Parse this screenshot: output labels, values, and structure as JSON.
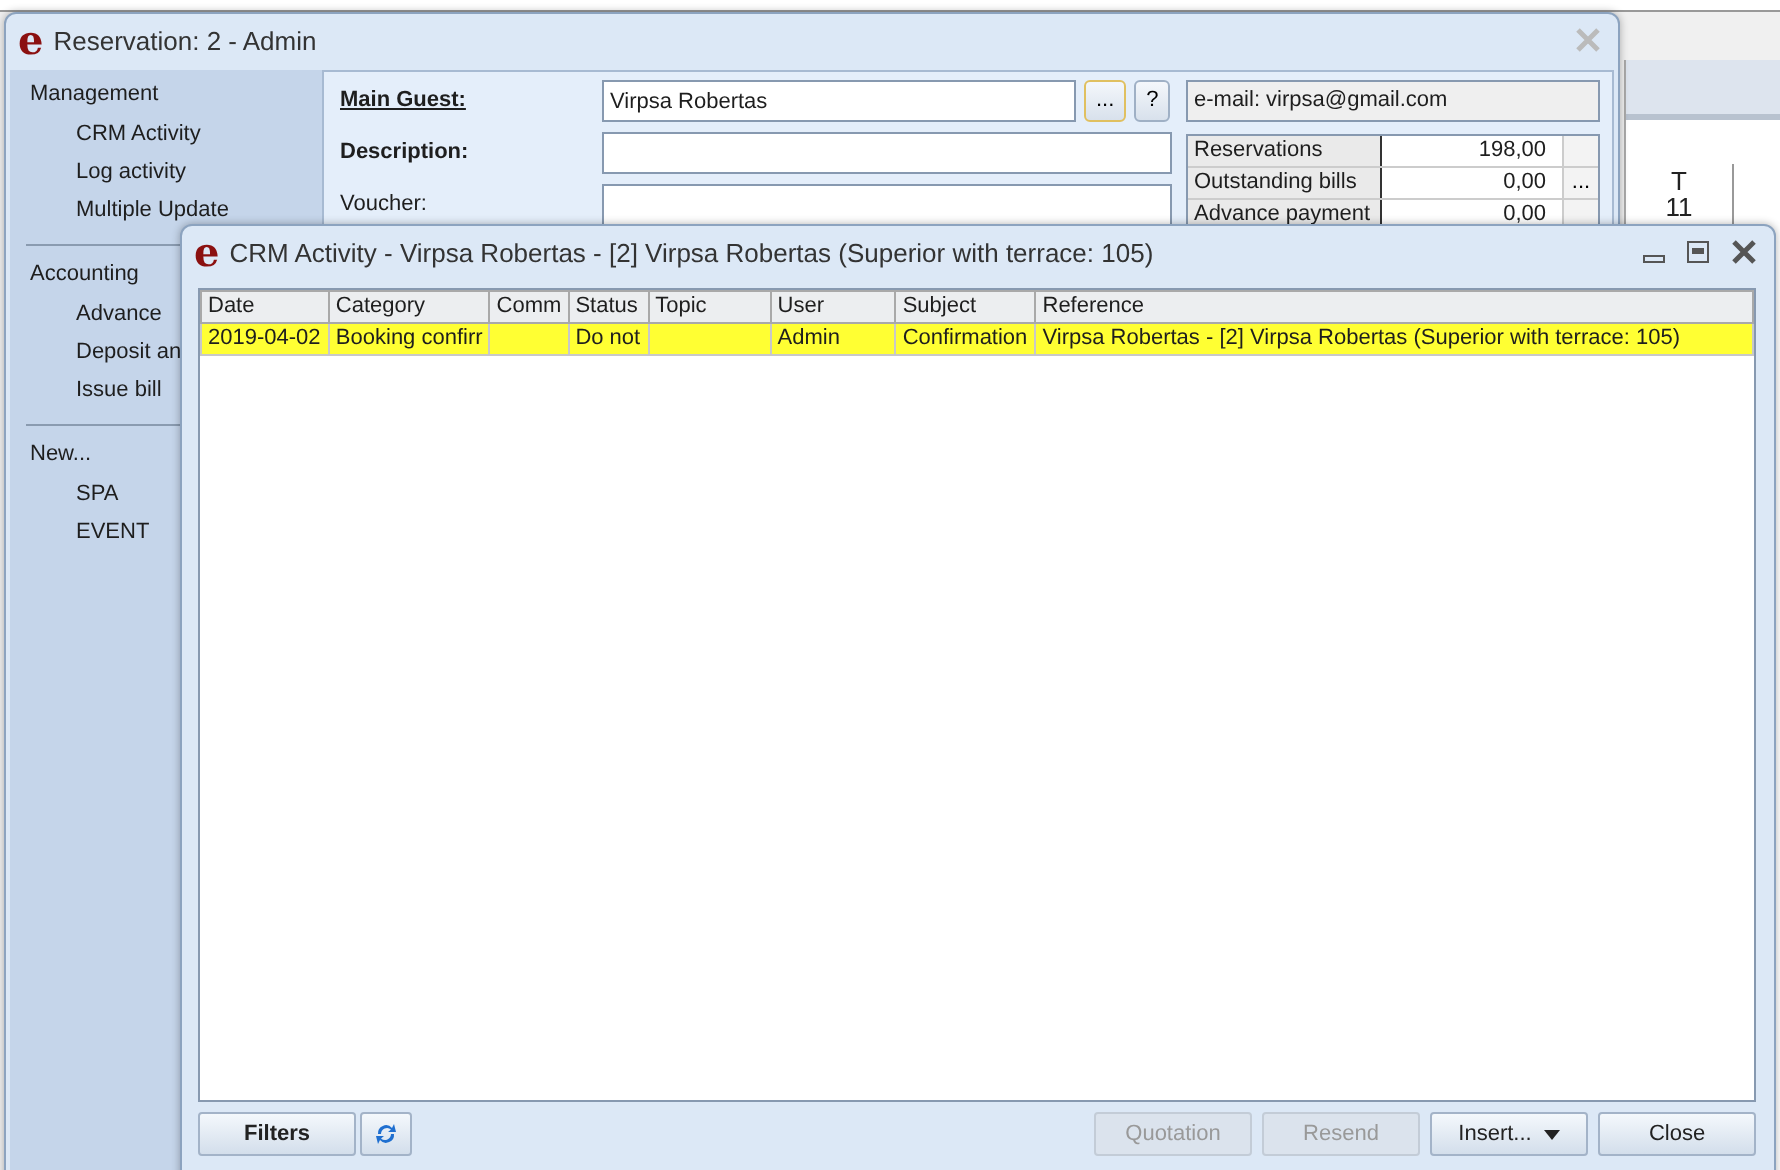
{
  "background_calendar": {
    "day": "T",
    "date": "11"
  },
  "reservation_window": {
    "logo": "e",
    "title": "Reservation: 2 - Admin",
    "sidebar": [
      {
        "heading": "Management",
        "items": [
          "CRM Activity",
          "Log activity",
          "Multiple Update"
        ]
      },
      {
        "heading": "Accounting",
        "items": [
          "Advance",
          "Deposit an",
          "Issue bill"
        ]
      },
      {
        "heading": "New...",
        "items": [
          "SPA",
          "EVENT"
        ]
      }
    ],
    "fields": [
      {
        "label": "Main Guest:",
        "kind": "guest",
        "value": "Virpsa Robertas"
      },
      {
        "label": "Description:",
        "kind": "bold"
      },
      {
        "label": "Voucher:",
        "kind": "plain"
      }
    ],
    "guest_buttons": [
      "...",
      "?"
    ],
    "email": "e-mail: virpsa@gmail.com",
    "summary": [
      {
        "label": "Reservations",
        "value": "198,00"
      },
      {
        "label": "Outstanding bills",
        "value": "0,00",
        "button": "..."
      },
      {
        "label": "Advance payment",
        "value": "0,00"
      }
    ]
  },
  "crm_window": {
    "logo": "e",
    "title": "CRM Activity - Virpsa Robertas - [2] Virpsa Robertas (Superior with terrace: 105)",
    "columns": [
      "Date",
      "Category",
      "Comm",
      "Status",
      "Topic",
      "User",
      "Subject",
      "Reference"
    ],
    "rows": [
      {
        "selected": true,
        "cells": [
          "2019-04-02",
          "Booking confirr",
          "",
          "Do not",
          "",
          "Admin",
          "Confirmation",
          "Virpsa Robertas - [2] Virpsa Robertas (Superior with terrace: 105)"
        ]
      }
    ],
    "left_buttons": [
      {
        "label": "Filters",
        "kind": "text"
      },
      {
        "kind": "refresh"
      }
    ],
    "right_buttons": [
      {
        "label": "Quotation",
        "disabled": true,
        "dropdown": false
      },
      {
        "label": "Resend",
        "disabled": true,
        "dropdown": false
      },
      {
        "label": "Insert...",
        "disabled": false,
        "dropdown": true
      },
      {
        "label": "Close",
        "disabled": false,
        "dropdown": false
      }
    ]
  }
}
